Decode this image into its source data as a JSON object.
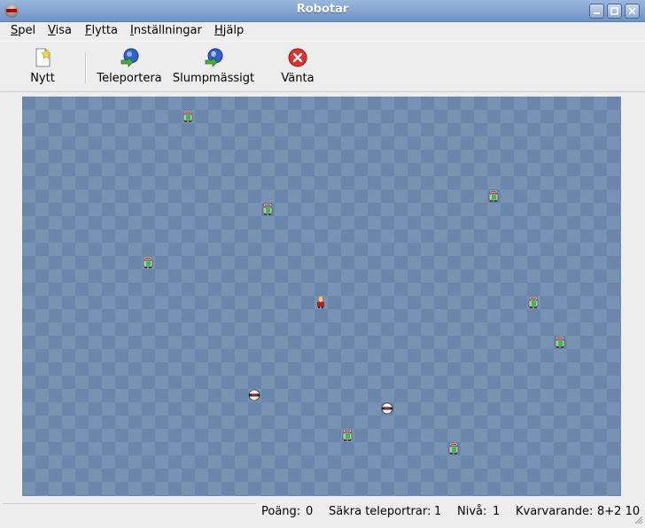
{
  "window": {
    "title": "Robotar"
  },
  "menu": [
    "Spel",
    "Visa",
    "Flytta",
    "Inställningar",
    "Hjälp"
  ],
  "toolbar": {
    "new_label": "Nytt",
    "teleport_label": "Teleportera",
    "random_label": "Slumpmässigt",
    "wait_label": "Vänta"
  },
  "board": {
    "colors": {
      "dark": "#6a87ab",
      "light": "#7792b3"
    },
    "player": {
      "col": 22,
      "row": 15
    },
    "robots": [
      {
        "col": 12,
        "row": 1
      },
      {
        "col": 35,
        "row": 7
      },
      {
        "col": 18,
        "row": 8
      },
      {
        "col": 9,
        "row": 12
      },
      {
        "col": 38,
        "row": 15
      },
      {
        "col": 40,
        "row": 18
      },
      {
        "col": 24,
        "row": 25
      },
      {
        "col": 32,
        "row": 26
      }
    ],
    "junk": [
      {
        "col": 17,
        "row": 22
      },
      {
        "col": 27,
        "row": 23
      }
    ]
  },
  "status": {
    "score_label": "Poäng:",
    "score_value": "0",
    "safe_label": "Säkra teleportrar:",
    "safe_value": "1",
    "level_label": "Nivå:",
    "level_value": "1",
    "remaining_label": "Kvarvarande:",
    "remaining_value": "8+2 10"
  }
}
